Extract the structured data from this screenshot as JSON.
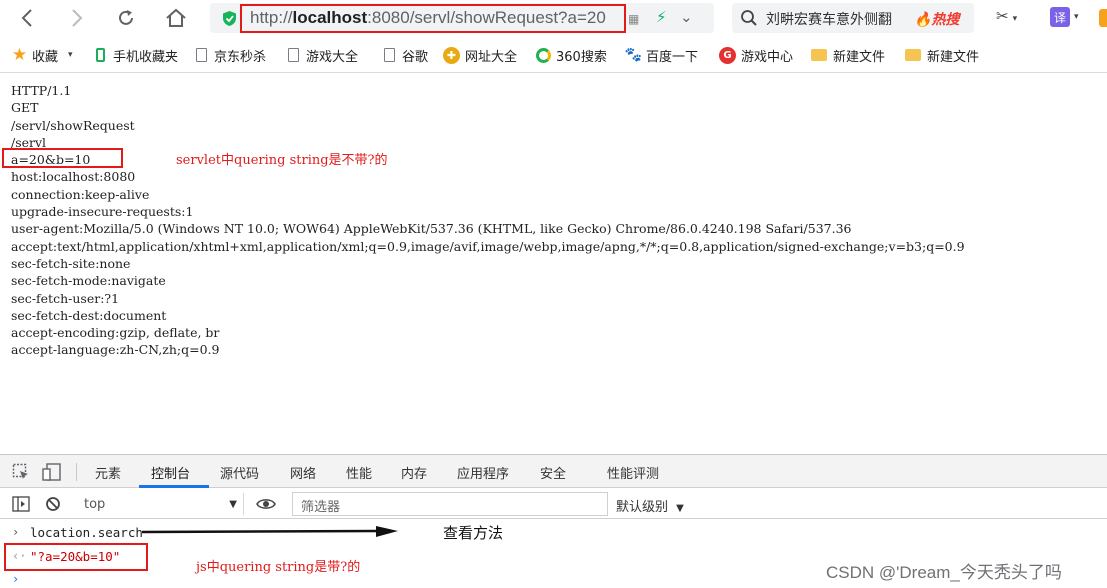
{
  "browser": {
    "url_prefix": "http://",
    "url_host": "localhost",
    "url_rest": ":8080/servl/showRequest?a=20",
    "search_text": "刘畊宏赛车意外侧翻",
    "hot_label": "热搜",
    "translate_label": "译"
  },
  "bookmarks": [
    {
      "label": "收藏",
      "icon": "star-icon"
    },
    {
      "label": "手机收藏夹",
      "icon": "phone-icon"
    },
    {
      "label": "京东秒杀",
      "icon": "document-icon"
    },
    {
      "label": "游戏大全",
      "icon": "document-icon"
    },
    {
      "label": "谷歌",
      "icon": "document-icon"
    },
    {
      "label": "网址大全",
      "icon": "site-nav-icon"
    },
    {
      "label": "360搜索",
      "icon": "search-360-icon"
    },
    {
      "label": "百度一下",
      "icon": "baidu-paw-icon"
    },
    {
      "label": "游戏中心",
      "icon": "game-center-icon"
    },
    {
      "label": "新建文件",
      "icon": "folder-icon"
    },
    {
      "label": "新建文件",
      "icon": "folder-icon"
    }
  ],
  "page_lines": [
    "HTTP/1.1",
    "GET",
    "/servl/showRequest",
    "/servl",
    "a=20&b=10",
    "host:localhost:8080",
    "connection:keep-alive",
    "upgrade-insecure-requests:1",
    "user-agent:Mozilla/5.0 (Windows NT 10.0; WOW64) AppleWebKit/537.36 (KHTML, like Gecko) Chrome/86.0.4240.198 Safari/537.36",
    "accept:text/html,application/xhtml+xml,application/xml;q=0.9,image/avif,image/webp,image/apng,*/*;q=0.8,application/signed-exchange;v=b3;q=0.9",
    "sec-fetch-site:none",
    "sec-fetch-mode:navigate",
    "sec-fetch-user:?1",
    "sec-fetch-dest:document",
    "accept-encoding:gzip, deflate, br",
    "accept-language:zh-CN,zh;q=0.9"
  ],
  "annotations": {
    "servlet_note": "servlet中quering string是不带?的",
    "method_note": "查看方法",
    "js_note": "js中quering string是带?的",
    "annotation_color": "#e21a1a"
  },
  "devtools": {
    "tabs": [
      "元素",
      "控制台",
      "源代码",
      "网络",
      "性能",
      "内存",
      "应用程序",
      "安全",
      "性能评测"
    ],
    "active_tab": "控制台",
    "context": "top",
    "filter_placeholder": "筛选器",
    "level": "默认级别",
    "command": "location.search",
    "result": "\"?a=20&b=10\""
  },
  "watermark": "CSDN @'Dream_今天秃头了吗"
}
